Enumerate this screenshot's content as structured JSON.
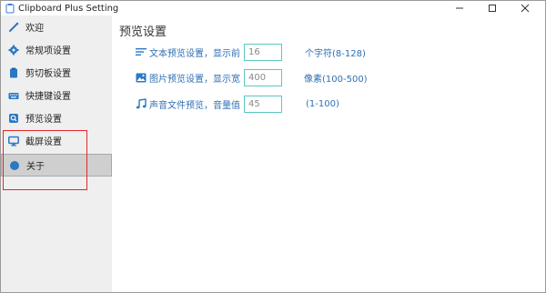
{
  "window": {
    "title": "Clipboard Plus Setting"
  },
  "sidebar": {
    "items": [
      {
        "label": "欢迎",
        "icon": "wand-icon"
      },
      {
        "label": "常规项设置",
        "icon": "gear-icon"
      },
      {
        "label": "剪切板设置",
        "icon": "clipboard-icon"
      },
      {
        "label": "快捷键设置",
        "icon": "keyboard-icon"
      },
      {
        "label": "预览设置",
        "icon": "preview-icon"
      },
      {
        "label": "截屏设置",
        "icon": "monitor-icon"
      },
      {
        "label": "关于",
        "icon": "info-icon"
      }
    ],
    "active_index": 6
  },
  "main": {
    "title": "预览设置",
    "rows": [
      {
        "icon": "text-lines-icon",
        "label": "文本预览设置，显示前",
        "value": "16",
        "hint": "个字符(8-128)"
      },
      {
        "icon": "image-icon",
        "label": "图片预览设置，显示宽",
        "value": "400",
        "hint": "像素(100-500)"
      },
      {
        "icon": "music-note-icon",
        "label": "声音文件预览，音量值",
        "value": "45",
        "hint": "(1-100)"
      }
    ]
  },
  "colors": {
    "accent_text": "#2e6fb5",
    "input_border": "#5cc7c2",
    "highlight_box": "#e0282e",
    "sidebar_bg": "#efefef",
    "active_bg": "#cfcfcf"
  }
}
